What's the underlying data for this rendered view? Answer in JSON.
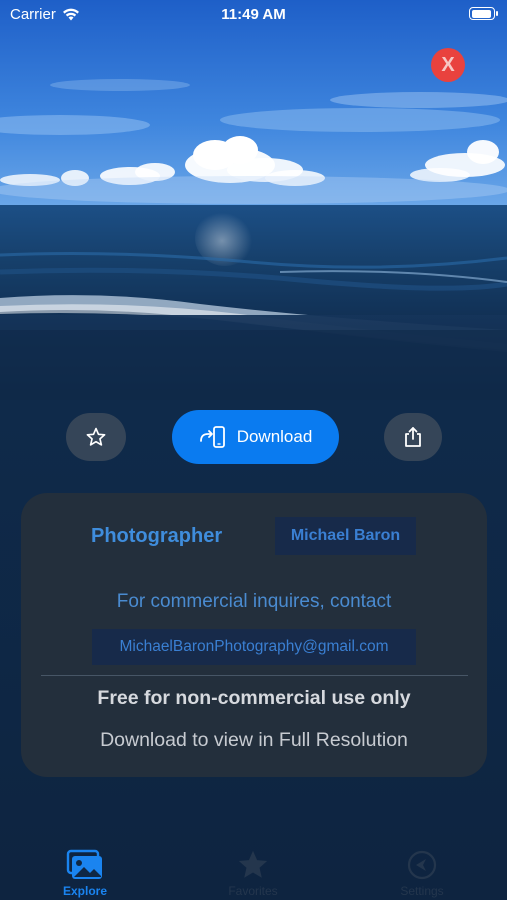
{
  "status_bar": {
    "carrier": "Carrier",
    "time": "11:49 AM"
  },
  "photo": {
    "subject": "ocean horizon with clouds"
  },
  "close": {
    "icon": "close-icon",
    "label": "X",
    "color": "#e9423e"
  },
  "actions": {
    "favorite_icon": "star-outline-icon",
    "download_label": "Download",
    "download_icon": "device-download-icon",
    "share_icon": "share-icon",
    "accent": "#0a7bf0"
  },
  "info": {
    "photographer_label": "Photographer",
    "photographer_name": "Michael Baron",
    "commercial_text": "For commercial inquires, contact",
    "email": "MichaelBaronPhotography@gmail.com",
    "license_text": "Free for non-commercial use only",
    "resolution_text": "Download to view in Full Resolution"
  },
  "tabs": [
    {
      "label": "Explore",
      "icon": "photos-icon",
      "active": true
    },
    {
      "label": "Favorites",
      "icon": "star-icon",
      "active": false
    },
    {
      "label": "Settings",
      "icon": "settings-icon",
      "active": false
    }
  ]
}
